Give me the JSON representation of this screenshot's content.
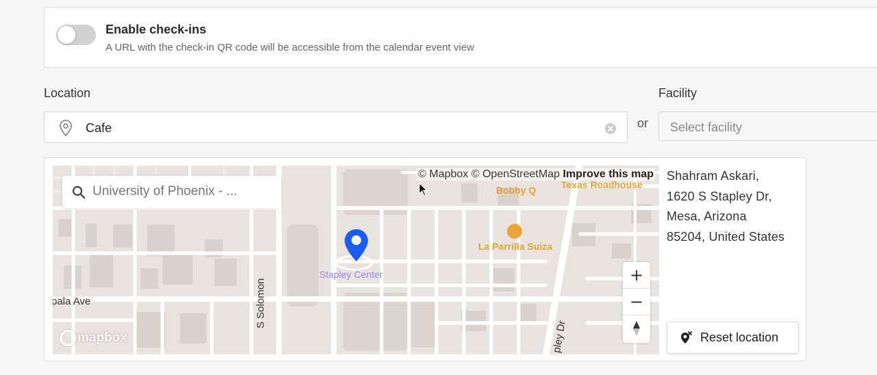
{
  "checkin": {
    "enabled": false,
    "title": "Enable check-ins",
    "description": "A URL with the check-in QR code will be accessible from the calendar event view"
  },
  "location": {
    "label": "Location",
    "value": "Cafe",
    "or_text": "or"
  },
  "facility": {
    "label": "Facility",
    "placeholder": "Select facility"
  },
  "map": {
    "search_value": "University of Phoenix - ...",
    "attribution": {
      "mapbox": "© Mapbox",
      "osm": "© OpenStreetMap",
      "improve": "Improve this map"
    },
    "pois": {
      "bobby_q": "Bobby Q",
      "texas_roadhouse": "Texas Roadhouse",
      "la_parrilla": "La Parrilla Suiza",
      "stapley_center": "Stapley Center"
    },
    "streets": {
      "pala_ave": "pala Ave",
      "s_solomon": "S Solomon",
      "stapley_dr": "pley Dr"
    },
    "zoom_in": "+",
    "zoom_out": "−",
    "logo": "mapbox",
    "colors": {
      "pin": "#1b5cf2",
      "poi_orange": "#e1a436",
      "poi_purple": "#9b87e6"
    }
  },
  "address": {
    "line1": "Shahram Askari,",
    "line2": "1620 S Stapley Dr,",
    "line3": "Mesa, Arizona",
    "line4": "85204, United States"
  },
  "reset_button": {
    "label": "Reset location"
  }
}
